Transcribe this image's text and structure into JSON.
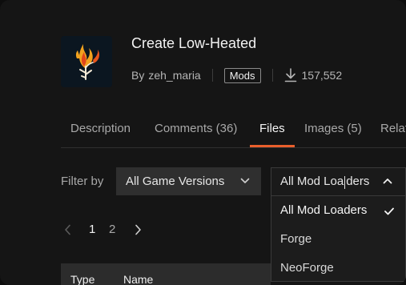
{
  "project": {
    "title": "Create Low-Heated",
    "by_label": "By",
    "author": "zeh_maria",
    "category_badge": "Mods",
    "downloads": "157,552"
  },
  "tabs": [
    {
      "label": "Description",
      "active": false
    },
    {
      "label": "Comments (36)",
      "active": false
    },
    {
      "label": "Files",
      "active": true
    },
    {
      "label": "Images (5)",
      "active": false
    },
    {
      "label": "Relat",
      "active": false
    }
  ],
  "filters": {
    "label": "Filter by",
    "game_versions": "All Game Versions",
    "mod_loaders_before_caret": "All Mod Loa",
    "mod_loaders_after_caret": "ders"
  },
  "loader_menu": {
    "options": [
      {
        "label": "All Mod Loaders",
        "selected": true
      },
      {
        "label": "Forge",
        "selected": false
      },
      {
        "label": "NeoForge",
        "selected": false
      }
    ]
  },
  "pagination": {
    "pages": [
      "1",
      "2"
    ],
    "current": "1"
  },
  "table": {
    "headers": [
      "Type",
      "Name"
    ]
  },
  "colors": {
    "accent": "#e95f2c",
    "background": "#151515",
    "dropdown_bg": "#2f2f2f"
  },
  "icons": [
    "flame-logo-icon",
    "download-icon",
    "chevron-down-icon",
    "chevron-up-icon",
    "checkmark-icon",
    "chevron-left-icon",
    "chevron-right-icon"
  ]
}
